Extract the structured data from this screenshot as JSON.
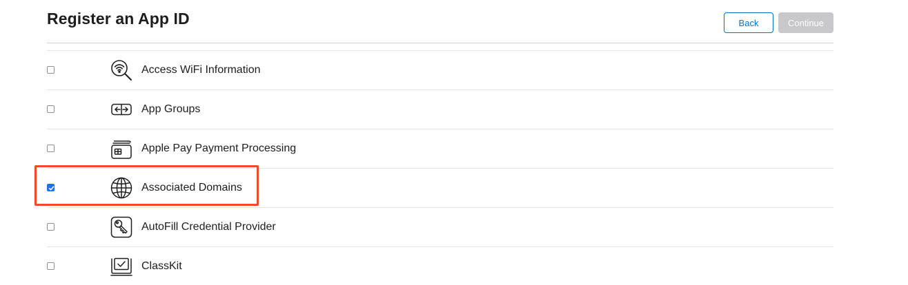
{
  "header": {
    "title": "Register an App ID",
    "back_label": "Back",
    "continue_label": "Continue"
  },
  "capabilities": [
    {
      "label": "Access WiFi Information",
      "icon": "wifi-search-icon",
      "checked": false
    },
    {
      "label": "App Groups",
      "icon": "app-groups-icon",
      "checked": false
    },
    {
      "label": "Apple Pay Payment Processing",
      "icon": "wallet-card-icon",
      "checked": false
    },
    {
      "label": "Associated Domains",
      "icon": "globe-icon",
      "checked": true
    },
    {
      "label": "AutoFill Credential Provider",
      "icon": "key-icon",
      "checked": false
    },
    {
      "label": "ClassKit",
      "icon": "classkit-icon",
      "checked": false
    }
  ],
  "colors": {
    "accent": "#0070c9",
    "highlight": "#ef4a28",
    "checkbox_checked": "#1a73e8"
  }
}
